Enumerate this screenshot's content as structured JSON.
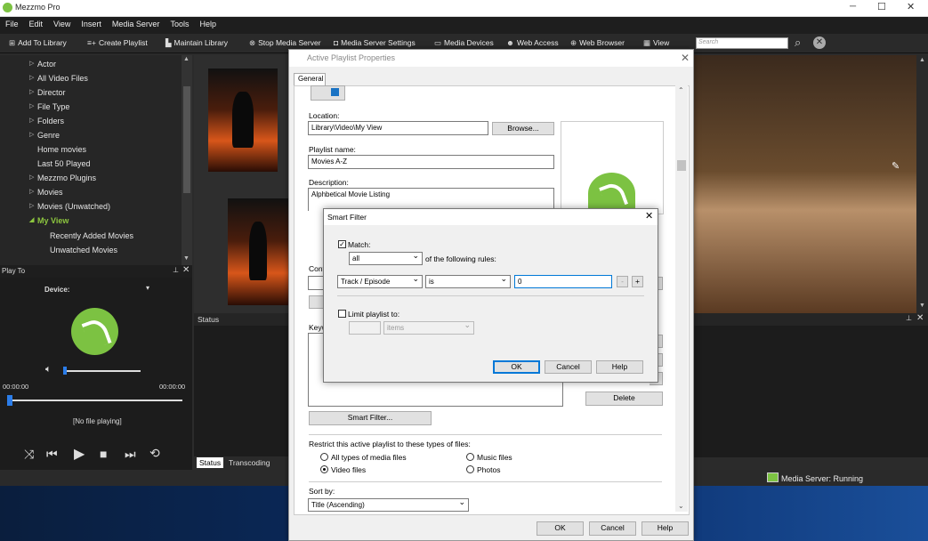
{
  "app": {
    "title": "Mezzmo Pro"
  },
  "window_controls": {
    "minimize": "─",
    "maximize": "☐",
    "close": "✕"
  },
  "menu": [
    "File",
    "Edit",
    "View",
    "Insert",
    "Media Server",
    "Tools",
    "Help"
  ],
  "toolbar": {
    "add_to_library": "Add To Library",
    "create_playlist": "Create Playlist",
    "maintain_library": "Maintain Library",
    "stop_media_server": "Stop Media Server",
    "media_server_settings": "Media Server Settings",
    "media_devices": "Media Devices",
    "web_access": "Web Access",
    "web_browser": "Web Browser",
    "view": "View",
    "search_placeholder": "Search"
  },
  "tree": {
    "items": [
      {
        "label": "Actor",
        "arrow": "▷"
      },
      {
        "label": "All Video Files",
        "arrow": "▷"
      },
      {
        "label": "Director",
        "arrow": "▷"
      },
      {
        "label": "File Type",
        "arrow": "▷"
      },
      {
        "label": "Folders",
        "arrow": "▷"
      },
      {
        "label": "Genre",
        "arrow": "▷"
      },
      {
        "label": "Home movies",
        "arrow": ""
      },
      {
        "label": "Last 50 Played",
        "arrow": ""
      },
      {
        "label": "Mezzmo Plugins",
        "arrow": "▷"
      },
      {
        "label": "Movies",
        "arrow": "▷"
      },
      {
        "label": "Movies (Unwatched)",
        "arrow": "▷"
      },
      {
        "label": "My View",
        "arrow": "◢"
      },
      {
        "label": "Recently Added Movies",
        "arrow": ""
      },
      {
        "label": "Unwatched Movies",
        "arrow": ""
      }
    ],
    "accent": "#8dc63f"
  },
  "playto": {
    "title": "Play To",
    "device_label": "Device:",
    "time_start": "00:00:00",
    "time_end": "00:00:00",
    "now_playing": "[No file playing]"
  },
  "status_panel": {
    "title": "Status"
  },
  "bottom_tabs": {
    "status": "Status",
    "transcoding": "Transcoding"
  },
  "server_status": "Media Server: Running",
  "dialog": {
    "title": "Active Playlist Properties",
    "tab": "General",
    "location_label": "Location:",
    "location_value": "Library\\Video\\My View",
    "browse": "Browse...",
    "playlist_name_label": "Playlist name:",
    "playlist_name_value": "Movies A-Z",
    "description_label": "Description:",
    "description_value": "Alphbetical Movie Listing",
    "content_label": "Cont",
    "keywords_label": "Keyw",
    "delete": "Delete",
    "smart_filter_button": "Smart Filter...",
    "restrict_label": "Restrict this active playlist to these types of files:",
    "types": {
      "all": "All types of media files",
      "video": "Video files",
      "music": "Music files",
      "photos": "Photos"
    },
    "sort_label": "Sort by:",
    "sort_value": "Title (Ascending)",
    "ok": "OK",
    "cancel": "Cancel",
    "help": "Help"
  },
  "smart_filter": {
    "title": "Smart Filter",
    "match_label": "Match:",
    "match_value": "all",
    "rules_suffix": "of the following rules:",
    "field": "Track / Episode",
    "operator": "is",
    "value": "0",
    "minus": "-",
    "plus": "+",
    "limit_label": "Limit playlist to:",
    "limit_unit": "items",
    "ok": "OK",
    "cancel": "Cancel",
    "help": "Help"
  }
}
